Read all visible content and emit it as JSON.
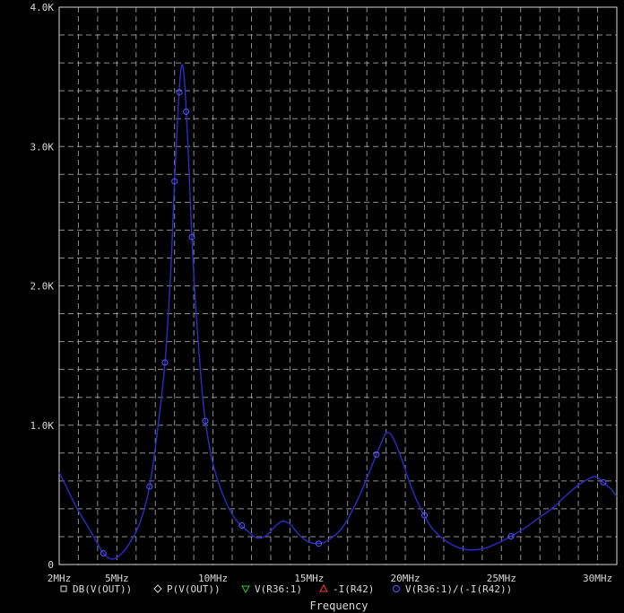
{
  "chart_data": {
    "type": "line",
    "xlabel": "Frequency",
    "ylabel": "",
    "title": "",
    "x_unit": "MHz",
    "xlim": [
      2,
      31
    ],
    "ylim": [
      0,
      4000
    ],
    "x_ticks": [
      {
        "value": 2,
        "label": "2MHz"
      },
      {
        "value": 5,
        "label": "5MHz"
      },
      {
        "value": 10,
        "label": "10MHz"
      },
      {
        "value": 15,
        "label": "15MHz"
      },
      {
        "value": 20,
        "label": "20MHz"
      },
      {
        "value": 25,
        "label": "25MHz"
      },
      {
        "value": 30,
        "label": "30MHz"
      }
    ],
    "y_ticks": [
      {
        "value": 0,
        "label": "0"
      },
      {
        "value": 1000,
        "label": "1.0K"
      },
      {
        "value": 2000,
        "label": "2.0K"
      },
      {
        "value": 3000,
        "label": "3.0K"
      },
      {
        "value": 4000,
        "label": "4.0K"
      }
    ],
    "grid": true,
    "background": "#000000",
    "grid_color": "#bdbdbd",
    "legend_position": "bottom",
    "legend": [
      {
        "marker": "square",
        "label": "DB(V(OUT))",
        "color": "#d8d8d8"
      },
      {
        "marker": "diamond",
        "label": "P(V(OUT))",
        "color": "#d8d8d8"
      },
      {
        "marker": "triangle-down",
        "label": "V(R36:1)",
        "color": "#2ecc40"
      },
      {
        "marker": "triangle-up",
        "label": "-I(R42)",
        "color": "#ff4136"
      },
      {
        "marker": "circle",
        "label": "V(R36:1)/(-I(R42))",
        "color": "#5b57ff"
      }
    ],
    "series": [
      {
        "name": "V(R36:1)/(-I(R42))",
        "color": "#2c2cc8",
        "marker_color": "#5b57ff",
        "points": [
          [
            2.0,
            660
          ],
          [
            2.4,
            550
          ],
          [
            2.9,
            410
          ],
          [
            3.5,
            270
          ],
          [
            4.0,
            150
          ],
          [
            4.3,
            80
          ],
          [
            4.7,
            40
          ],
          [
            5.1,
            60
          ],
          [
            5.6,
            140
          ],
          [
            6.2,
            300
          ],
          [
            6.7,
            560
          ],
          [
            7.1,
            950
          ],
          [
            7.5,
            1450
          ],
          [
            7.8,
            2100
          ],
          [
            8.0,
            2750
          ],
          [
            8.2,
            3300
          ],
          [
            8.35,
            3570
          ],
          [
            8.5,
            3500
          ],
          [
            8.7,
            3000
          ],
          [
            8.9,
            2350
          ],
          [
            9.1,
            1850
          ],
          [
            9.4,
            1300
          ],
          [
            9.6,
            1030
          ],
          [
            10.0,
            720
          ],
          [
            10.6,
            470
          ],
          [
            11.2,
            320
          ],
          [
            11.8,
            240
          ],
          [
            12.3,
            190
          ],
          [
            12.8,
            210
          ],
          [
            13.2,
            270
          ],
          [
            13.6,
            310
          ],
          [
            14.0,
            290
          ],
          [
            14.5,
            210
          ],
          [
            15.0,
            160
          ],
          [
            15.5,
            150
          ],
          [
            16.0,
            175
          ],
          [
            16.7,
            260
          ],
          [
            17.4,
            430
          ],
          [
            18.0,
            620
          ],
          [
            18.5,
            790
          ],
          [
            18.9,
            920
          ],
          [
            19.1,
            950
          ],
          [
            19.4,
            900
          ],
          [
            19.8,
            760
          ],
          [
            20.3,
            560
          ],
          [
            20.8,
            400
          ],
          [
            21.4,
            260
          ],
          [
            22.1,
            170
          ],
          [
            22.8,
            120
          ],
          [
            23.5,
            105
          ],
          [
            24.2,
            120
          ],
          [
            24.9,
            160
          ],
          [
            25.6,
            210
          ],
          [
            26.3,
            270
          ],
          [
            27.0,
            340
          ],
          [
            27.7,
            410
          ],
          [
            28.4,
            500
          ],
          [
            29.0,
            570
          ],
          [
            29.6,
            620
          ],
          [
            29.9,
            630
          ],
          [
            30.3,
            590
          ],
          [
            30.7,
            540
          ],
          [
            31.0,
            490
          ]
        ],
        "markers_at": [
          4.3,
          6.7,
          7.5,
          8.0,
          8.25,
          8.6,
          8.9,
          9.6,
          11.5,
          15.5,
          18.5,
          21.0,
          25.5,
          30.3
        ]
      }
    ]
  }
}
